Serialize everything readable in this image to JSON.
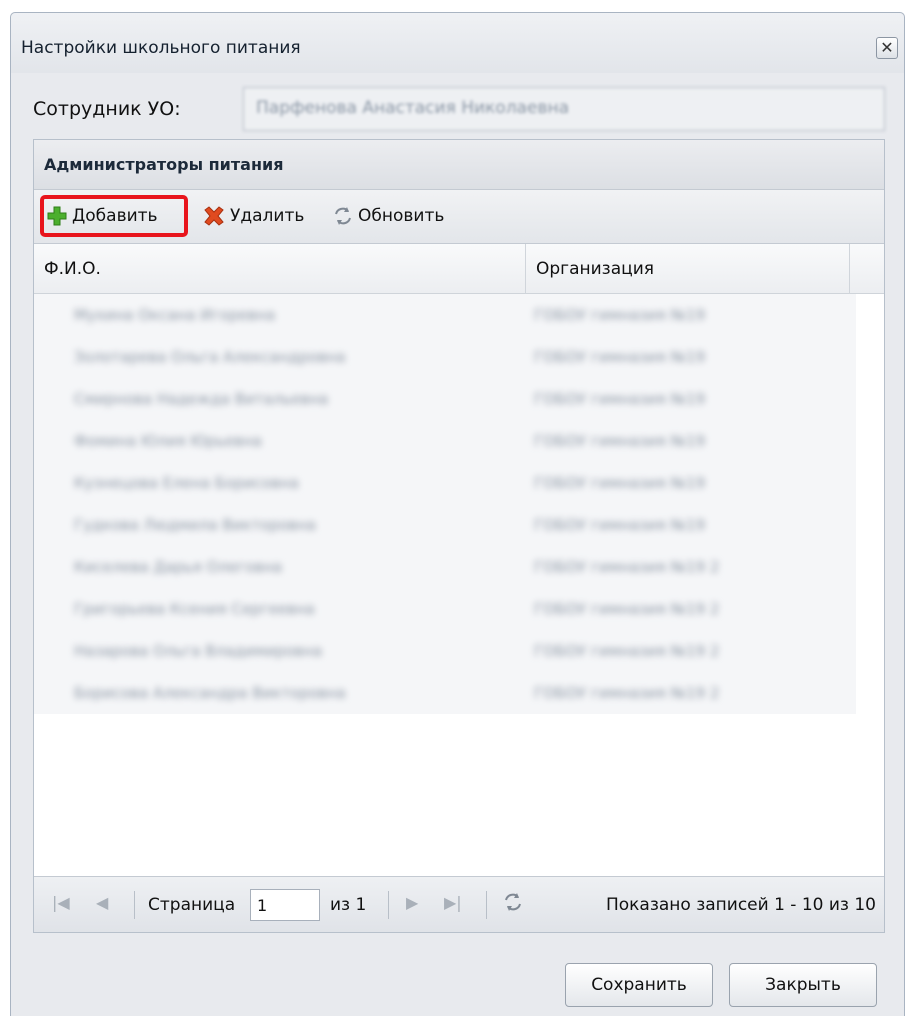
{
  "window": {
    "title": "Настройки школьного питания",
    "close_glyph": "✕"
  },
  "employee": {
    "label": "Сотрудник УО:",
    "value": "Парфенова Анастасия Николаевна"
  },
  "panel": {
    "title": "Администраторы питания"
  },
  "toolbar": {
    "add_label": "Добавить",
    "delete_label": "Удалить",
    "refresh_label": "Обновить"
  },
  "grid": {
    "columns": [
      "Ф.И.О.",
      "Организация"
    ],
    "rows": [
      {
        "name": "Мухина Оксана Игоревна",
        "org": "ГОБОУ гимназия №19"
      },
      {
        "name": "Золотарева Ольга Александровна",
        "org": "ГОБОУ гимназия №19"
      },
      {
        "name": "Смирнова Надежда Витальевна",
        "org": "ГОБОУ гимназия №19"
      },
      {
        "name": "Фомина Юлия Юрьевна",
        "org": "ГОБОУ гимназия №19"
      },
      {
        "name": "Кузнецова Елена Борисовна",
        "org": "ГОБОУ гимназия №19"
      },
      {
        "name": "Гудкова Людмила Викторовна",
        "org": "ГОБОУ гимназия №19"
      },
      {
        "name": "Киселева Дарья Олеговна",
        "org": "ГОБОУ гимназия №19 2"
      },
      {
        "name": "Григорьева Ксения Сергеевна",
        "org": "ГОБОУ гимназия №19 2"
      },
      {
        "name": "Назарова Ольга Владимировна",
        "org": "ГОБОУ гимназия №19 2"
      },
      {
        "name": "Борисова Александра Викторовна",
        "org": "ГОБОУ гимназия №19 2"
      }
    ]
  },
  "pager": {
    "page_label": "Страница",
    "page_value": "1",
    "of_label": "из 1",
    "summary": "Показано записей 1 - 10 из 10"
  },
  "footer": {
    "save_label": "Сохранить",
    "close_label": "Закрыть"
  },
  "colors": {
    "highlight": "#e8141c",
    "add_icon": "#4caf2e",
    "delete_icon": "#e04a1f"
  }
}
